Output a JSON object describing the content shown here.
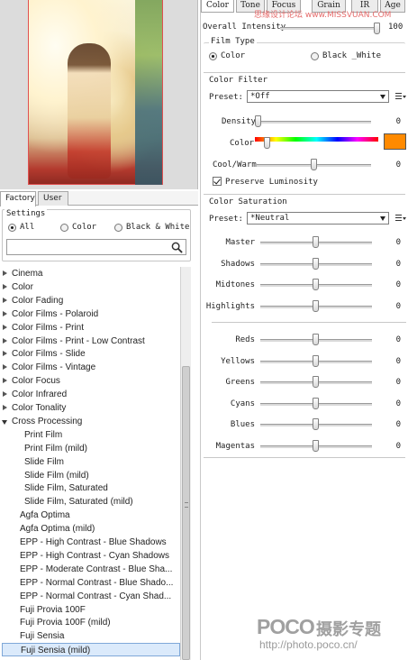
{
  "left": {
    "tabs": [
      "Factory",
      "User"
    ],
    "settings": {
      "legend": "Settings",
      "options": [
        "All",
        "Color",
        "Black & White"
      ],
      "selected": "All"
    },
    "search": {
      "value": "",
      "placeholder": ""
    },
    "tree": [
      {
        "label": "Cinema",
        "level": 0,
        "expander": "collapsed"
      },
      {
        "label": "Color",
        "level": 0,
        "expander": "collapsed"
      },
      {
        "label": "Color Fading",
        "level": 0,
        "expander": "collapsed"
      },
      {
        "label": "Color Films - Polaroid",
        "level": 0,
        "expander": "collapsed"
      },
      {
        "label": "Color Films - Print",
        "level": 0,
        "expander": "collapsed"
      },
      {
        "label": "Color Films - Print - Low Contrast",
        "level": 0,
        "expander": "collapsed"
      },
      {
        "label": "Color Films - Slide",
        "level": 0,
        "expander": "collapsed"
      },
      {
        "label": "Color Films - Vintage",
        "level": 0,
        "expander": "collapsed"
      },
      {
        "label": "Color Focus",
        "level": 0,
        "expander": "collapsed"
      },
      {
        "label": "Color Infrared",
        "level": 0,
        "expander": "collapsed"
      },
      {
        "label": "Color Tonality",
        "level": 0,
        "expander": "collapsed"
      },
      {
        "label": "Cross Processing",
        "level": 0,
        "expander": "expanded"
      },
      {
        "label": "Print Film",
        "level": 2
      },
      {
        "label": "Print Film (mild)",
        "level": 2
      },
      {
        "label": "Slide Film",
        "level": 2
      },
      {
        "label": "Slide Film (mild)",
        "level": 2
      },
      {
        "label": "Slide Film, Saturated",
        "level": 2
      },
      {
        "label": "Slide Film, Saturated (mild)",
        "level": 2
      },
      {
        "label": "Agfa Optima",
        "level": 1
      },
      {
        "label": "Agfa Optima (mild)",
        "level": 1
      },
      {
        "label": "EPP - High Contrast - Blue Shadows",
        "level": 1
      },
      {
        "label": "EPP - High Contrast - Cyan Shadows",
        "level": 1
      },
      {
        "label": "EPP - Moderate Contrast - Blue Sha...",
        "level": 1
      },
      {
        "label": "EPP - Normal Contrast - Blue Shado...",
        "level": 1
      },
      {
        "label": "EPP - Normal Contrast - Cyan Shad...",
        "level": 1
      },
      {
        "label": "Fuji Provia 100F",
        "level": 1
      },
      {
        "label": "Fuji Provia 100F (mild)",
        "level": 1
      },
      {
        "label": "Fuji Sensia",
        "level": 1
      },
      {
        "label": "Fuji Sensia (mild)",
        "level": 1,
        "selected": true
      }
    ]
  },
  "right": {
    "tabs": [
      "Color",
      "Tone",
      "Focus",
      "Grain",
      "IR",
      "Age"
    ],
    "active_tab": "Color",
    "overall_intensity": {
      "label": "Overall Intensity",
      "value": "100",
      "level": 1.0
    },
    "film_type": {
      "legend": "Film Type",
      "options": [
        "Color",
        "Black _White"
      ],
      "selected": "Color"
    },
    "color_filter": {
      "legend": "Color Filter",
      "preset_label": "Preset:",
      "preset_value": "*Off",
      "density": {
        "label": "Density",
        "value": "0",
        "level": 0.0
      },
      "color": {
        "label": "Color",
        "level": 0.08,
        "swatch": "#ff8a00"
      },
      "cool_warm": {
        "label": "Cool/Warm",
        "value": "0",
        "level": 0.5
      },
      "preserve": {
        "label": "Preserve Luminosity",
        "checked": true
      }
    },
    "color_saturation": {
      "legend": "Color Saturation",
      "preset_label": "Preset:",
      "preset_value": "*Neutral",
      "tone_sliders": [
        {
          "label": "Master",
          "value": "0",
          "level": 0.5
        },
        {
          "label": "Shadows",
          "value": "0",
          "level": 0.5
        },
        {
          "label": "Midtones",
          "value": "0",
          "level": 0.5
        },
        {
          "label": "Highlights",
          "value": "0",
          "level": 0.5
        }
      ],
      "color_sliders": [
        {
          "label": "Reds",
          "value": "0",
          "level": 0.5
        },
        {
          "label": "Yellows",
          "value": "0",
          "level": 0.5
        },
        {
          "label": "Greens",
          "value": "0",
          "level": 0.5
        },
        {
          "label": "Cyans",
          "value": "0",
          "level": 0.5
        },
        {
          "label": "Blues",
          "value": "0",
          "level": 0.5
        },
        {
          "label": "Magentas",
          "value": "0",
          "level": 0.5
        }
      ]
    }
  },
  "watermark": {
    "top": "思缘设计论坛 www.MISSVUAN.COM",
    "logo": "POCO",
    "brand": "摄影专题",
    "url": "http://photo.poco.cn/"
  },
  "colors": {
    "accent_swatch": "#ff8a00",
    "selection": "#dbeafb"
  }
}
